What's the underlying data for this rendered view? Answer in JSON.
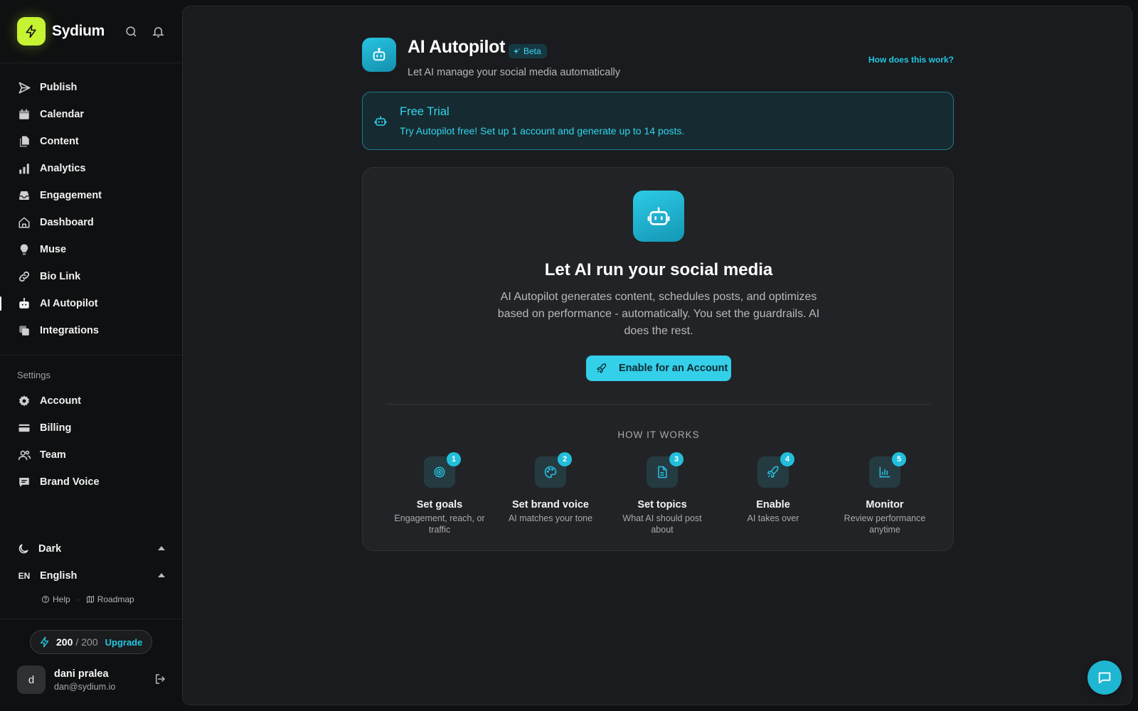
{
  "brand": {
    "name": "Sydium",
    "accent": "#c6f432",
    "logo_icon": "bolt-icon"
  },
  "header_icons": [
    "search-icon",
    "bell-icon"
  ],
  "nav": {
    "items": [
      {
        "label": "Publish",
        "icon": "send-icon"
      },
      {
        "label": "Calendar",
        "icon": "calendar-icon"
      },
      {
        "label": "Content",
        "icon": "documents-icon"
      },
      {
        "label": "Analytics",
        "icon": "bar-chart-icon"
      },
      {
        "label": "Engagement",
        "icon": "inbox-icon"
      },
      {
        "label": "Dashboard",
        "icon": "home-icon"
      },
      {
        "label": "Muse",
        "icon": "lightbulb-icon"
      },
      {
        "label": "Bio Link",
        "icon": "link-icon"
      },
      {
        "label": "AI Autopilot",
        "icon": "robot-icon",
        "active": true
      },
      {
        "label": "Integrations",
        "icon": "stack-icon"
      }
    ]
  },
  "settings": {
    "label": "Settings",
    "items": [
      {
        "label": "Account",
        "icon": "gear-icon"
      },
      {
        "label": "Billing",
        "icon": "credit-card-icon"
      },
      {
        "label": "Team",
        "icon": "users-icon"
      },
      {
        "label": "Brand Voice",
        "icon": "message-icon"
      }
    ]
  },
  "prefs": {
    "theme": {
      "label": "Dark",
      "icon": "moon-icon"
    },
    "language": {
      "code": "EN",
      "label": "English"
    }
  },
  "links": {
    "help": "Help",
    "roadmap": "Roadmap"
  },
  "credits": {
    "used": "200",
    "total": "200",
    "upgrade": "Upgrade"
  },
  "user": {
    "initial": "d",
    "name": "dani pralea",
    "email": "dan@sydium.io"
  },
  "page": {
    "title": "AI Autopilot",
    "badge": "Beta",
    "subtitle": "Let AI manage your social media automatically",
    "help_link": "How does this work?"
  },
  "trial": {
    "title": "Free Trial",
    "text": "Try Autopilot free! Set up 1 account and generate up to 14 posts."
  },
  "hero": {
    "title": "Let AI run your social media",
    "description": "AI Autopilot generates content, schedules posts, and optimizes based on performance - automatically. You set the guardrails. AI does the rest.",
    "button": "Enable for an Account"
  },
  "how_it_works": {
    "title": "HOW IT WORKS",
    "steps": [
      {
        "num": "1",
        "title": "Set goals",
        "desc": "Engagement, reach, or traffic",
        "icon": "target-icon"
      },
      {
        "num": "2",
        "title": "Set brand voice",
        "desc": "AI matches your tone",
        "icon": "palette-icon"
      },
      {
        "num": "3",
        "title": "Set topics",
        "desc": "What AI should post about",
        "icon": "document-icon"
      },
      {
        "num": "4",
        "title": "Enable",
        "desc": "AI takes over",
        "icon": "rocket-icon"
      },
      {
        "num": "5",
        "title": "Monitor",
        "desc": "Review performance anytime",
        "icon": "chart-icon"
      }
    ]
  },
  "colors": {
    "primary": "#22c7e3",
    "background": "#0f1011",
    "panel": "#1a1b1e"
  }
}
